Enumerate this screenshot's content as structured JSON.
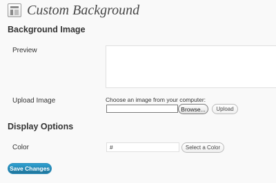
{
  "header": {
    "title": "Custom Background",
    "icon": "appearance-icon"
  },
  "background_image": {
    "section_title": "Background Image",
    "preview_label": "Preview",
    "upload_label": "Upload Image",
    "upload_hint": "Choose an image from your computer:",
    "file_value": "",
    "browse_label": "Browse...",
    "upload_button": "Upload"
  },
  "display_options": {
    "section_title": "Display Options",
    "color_label": "Color",
    "color_value": "#",
    "select_color_button": "Select a Color"
  },
  "save_button": "Save Changes",
  "colors": {
    "primary_button": "#21759b",
    "page_background": "#f9f9f9"
  }
}
